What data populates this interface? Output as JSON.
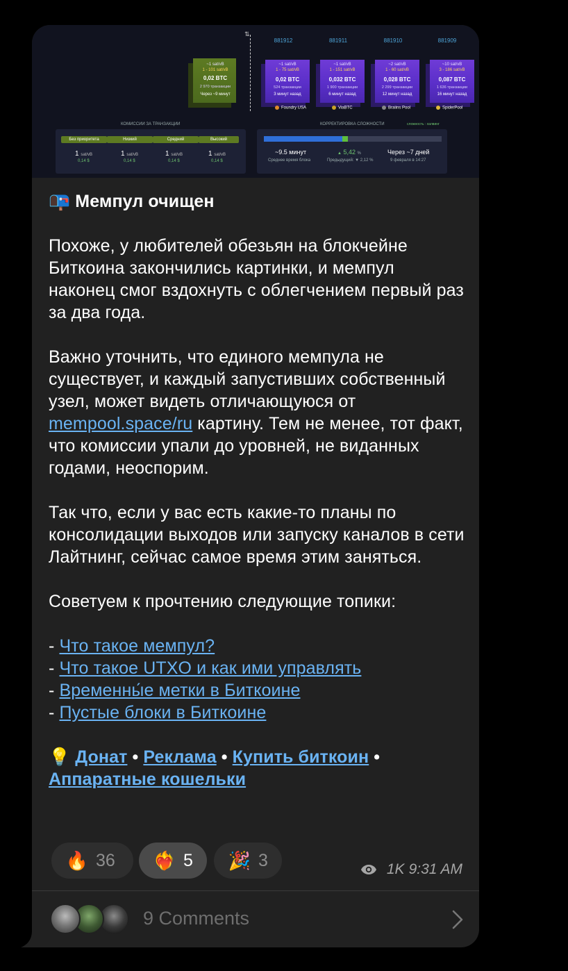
{
  "preview": {
    "block_heights": [
      "881912",
      "881911",
      "881910",
      "881909"
    ],
    "arrows_glyph": "⇅",
    "pending_block": {
      "fee_range_top": "~1 sat/vB",
      "fee_range": "1 - 101 sat/vB",
      "btc": "0,02 BTC",
      "tx": "2 970 транзакции",
      "eta": "Через ~9 минут"
    },
    "mined_blocks": [
      {
        "fee_top": "~1 sat/vB",
        "fee_range": "1 - 75 sat/vB",
        "btc": "0,02 BTC",
        "tx": "524 транзакции",
        "ago": "3 минут назад",
        "pool": "Foundry USA",
        "pool_color": "#e08a2a"
      },
      {
        "fee_top": "~1 sat/vB",
        "fee_range": "1 - 151 sat/vB",
        "btc": "0,032 BTC",
        "tx": "1 900 транзакции",
        "ago": "6 минут назад",
        "pool": "ViaBTC",
        "pool_color": "#c9a227"
      },
      {
        "fee_top": "~2 sat/vB",
        "fee_range": "1 - 60 sat/vB",
        "btc": "0,028 BTC",
        "tx": "2 299 транзакции",
        "ago": "12 минут назад",
        "pool": "Braiins Pool",
        "pool_color": "#888888"
      },
      {
        "fee_top": "~10 sat/vB",
        "fee_range": "3 - 186 sat/vB",
        "btc": "0,087 BTC",
        "tx": "1 636 транзакции",
        "ago": "16 минут назад",
        "pool": "SpiderPool",
        "pool_color": "#e0b93a"
      }
    ],
    "fees_title": "КОМИССИИ ЗА ТРАНЗАКЦИИ",
    "fee_levels": [
      {
        "label": "Без приоритета",
        "value": "1",
        "unit": "sat/vB",
        "usd": "0,14 $"
      },
      {
        "label": "Низкий",
        "value": "1",
        "unit": "sat/vB",
        "usd": "0,14 $"
      },
      {
        "label": "Средний",
        "value": "1",
        "unit": "sat/vB",
        "usd": "0,14 $"
      },
      {
        "label": "Высокий",
        "value": "1",
        "unit": "sat/vB",
        "usd": "0,14 $"
      }
    ],
    "difficulty_title": "КОРРЕКТИРОВКА СЛОЖНОСТИ",
    "difficulty_tag": "сложность : халвинг",
    "difficulty_progress_pct": 44,
    "difficulty": {
      "avg_time": "~9.5 минут",
      "avg_time_label": "Среднее время блока",
      "change": "5,42",
      "change_unit": "%",
      "change_arrow": "▲",
      "previous": "Предыдущий: ▼ 2,12 %",
      "next": "Через ~7 дней",
      "next_date": "9 февраля в 14:27"
    }
  },
  "post": {
    "title_emoji": "📭",
    "title": "Мемпул очищен",
    "p1": "Похоже, у любителей обезьян на блокчейне Биткоина закончились картинки, и мемпул наконец смог вздохнуть с облегчением первый раз за два года.",
    "p2_a": "Важно уточнить, что единого мемпула не существует, и каждый запустивших собственный узел, может видеть отличающуюся от ",
    "p2_link": "mempool.space/ru",
    "p2_b": " картину. Тем не менее, тот факт, что комиссии упали до уровней, не виданных годами, неоспорим.",
    "p3": "Так что, если у вас есть какие-то планы по консолидации выходов или запуску каналов в сети Лайтнинг, сейчас самое время этим заняться.",
    "p4": "Советуем к прочтению следующие топики:",
    "bullet": "- ",
    "topics": [
      "Что такое мемпул?",
      "Что такое UTXO и как ими управлять",
      "Временны́е метки в Биткоине",
      "Пустые блоки в Биткоине"
    ],
    "sig_emoji": "💡",
    "sig_links": [
      "Донат",
      "Реклама",
      "Купить биткоин",
      "Аппаратные кошельки"
    ],
    "sig_sep": " • "
  },
  "reactions": [
    {
      "emoji": "🔥",
      "count": "36",
      "active": false
    },
    {
      "emoji": "❤️‍🔥",
      "count": "5",
      "active": true
    },
    {
      "emoji": "🎉",
      "count": "3",
      "active": false
    }
  ],
  "meta": {
    "views": "1K",
    "time": "9:31 AM"
  },
  "comments": {
    "label": "9 Comments"
  }
}
